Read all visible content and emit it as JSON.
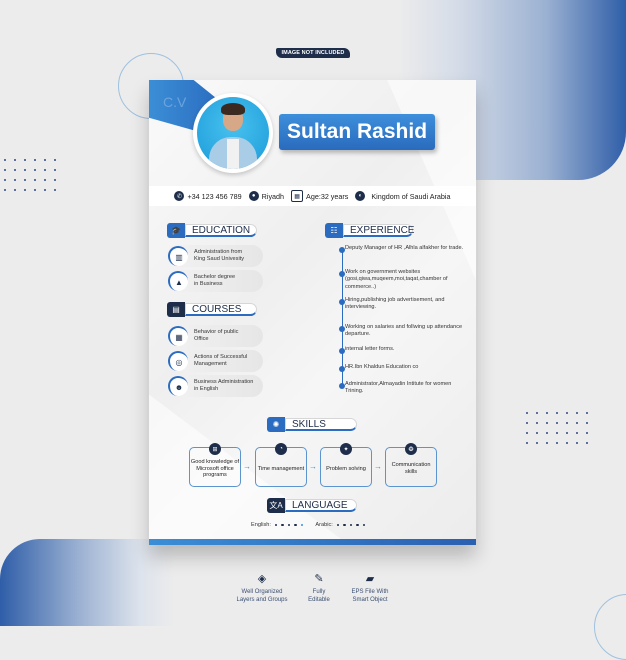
{
  "badge": "IMAGE NOT INCLUDED",
  "cv_label": "C.V",
  "name": "Sultan Rashid",
  "contact": {
    "phone": "+34 123 456 789",
    "city": "Riyadh",
    "age": "Age:32 years",
    "country": "Kingdom of Saudi Arabia"
  },
  "education": {
    "title": "EDUCATION",
    "items": [
      {
        "icon": "building-icon",
        "text_line1": "Administration from",
        "text_line2": "King Saud Univesity"
      },
      {
        "icon": "graduation-cap-icon",
        "text_line1": "Bachelor degree",
        "text_line2": "in Business"
      }
    ]
  },
  "courses": {
    "title": "COURSES",
    "items": [
      {
        "icon": "office-icon",
        "text_line1": "Behavior of public",
        "text_line2": "Office"
      },
      {
        "icon": "target-icon",
        "text_line1": "Actions of Successful",
        "text_line2": "Management"
      },
      {
        "icon": "business-person-icon",
        "text_line1": "Business Administration",
        "text_line2": "in English"
      }
    ]
  },
  "experience": {
    "title": "EXPERIENCE",
    "items": [
      "Deputy Manager of HR ,Alhla alfakher for trade.",
      "Work on government websites (gosi,qiwa,muqeem,moi,taqat,chamber of commerce..)",
      "Hiring,publishing job advertisement, and interviewing.",
      "Working on salaries and follwing up attendance departure.",
      "internal letter forms.",
      "HR.Ibn Khaldun Education co",
      "Administrator,Almayadin Intitute for women Trining."
    ]
  },
  "skills": {
    "title": "SKILLS",
    "items": [
      {
        "icon": "windows-icon",
        "label": "Good knowledge of Microsoft office programs"
      },
      {
        "icon": "clock-icon",
        "label": "Time management"
      },
      {
        "icon": "puzzle-icon",
        "label": "Problem solving"
      },
      {
        "icon": "chat-icon",
        "label": "Communication skills"
      }
    ]
  },
  "language": {
    "title": "LANGUAGE",
    "english_label": "English:",
    "english_level": 4,
    "arabic_label": "Arabic:",
    "arabic_level": 5,
    "scale_max": 5
  },
  "features": [
    {
      "icon": "layers-icon",
      "line1": "Well Organized",
      "line2": "Layers and Groups"
    },
    {
      "icon": "edit-icon",
      "line1": "Fully",
      "line2": "Editable"
    },
    {
      "icon": "folder-icon",
      "line1": "EPS File With",
      "line2": "Smart Object"
    }
  ]
}
